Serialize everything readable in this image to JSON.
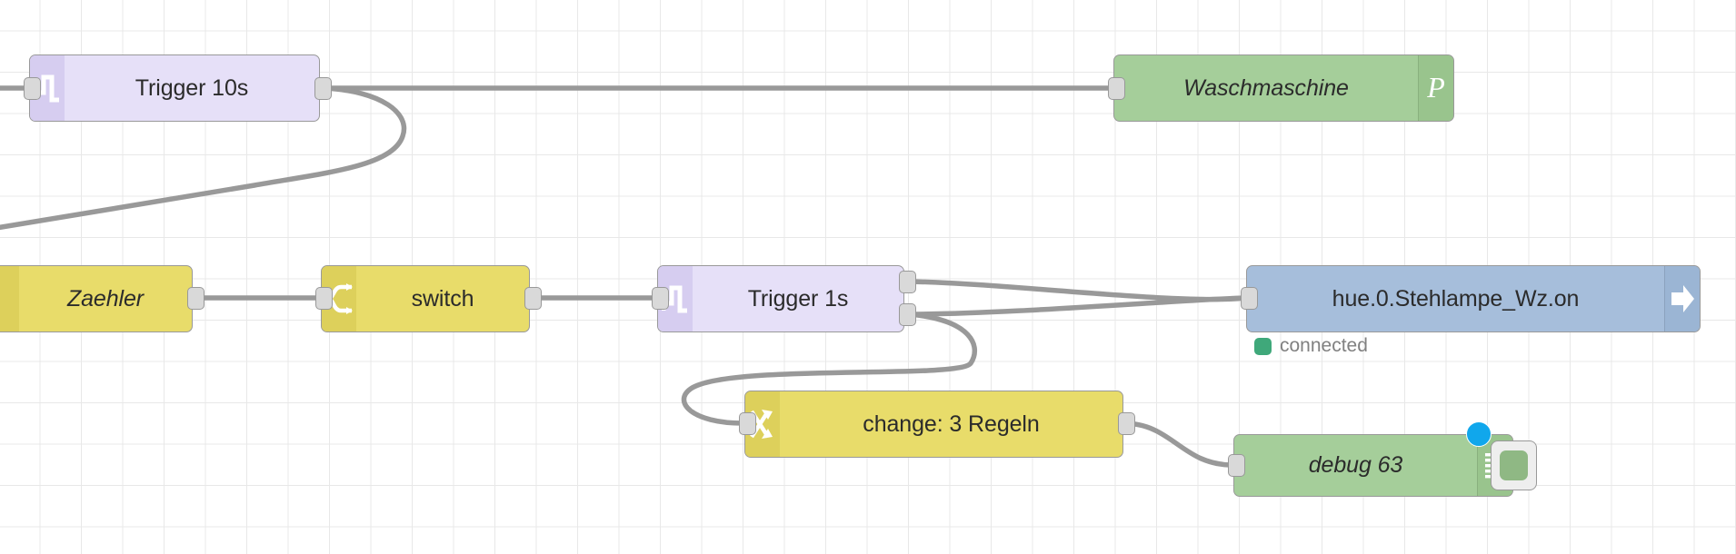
{
  "canvas": {
    "name": "node-red-flow-canvas",
    "grid_color": "#e8e8e8",
    "background": "#ffffff",
    "wire_color": "#999999"
  },
  "palette": {
    "trigger_fill": "#e6e0f8",
    "function_fill": "#e8dc6a",
    "green_fill": "#a5ce9a",
    "blue_fill": "#a6bedb",
    "port_fill": "#d9d9d9",
    "status_green": "#3fa87a",
    "badge_blue": "#10a7ec"
  },
  "nodes": {
    "trigger10s": {
      "label": "Trigger 10s",
      "icon": "pulse-icon",
      "type": "trigger"
    },
    "waschmaschine": {
      "label": "Waschmaschine",
      "icon": "pushover-p-icon",
      "type": "notification"
    },
    "zaehler": {
      "label": "Zaehler",
      "icon": "function-icon",
      "type": "function"
    },
    "switch": {
      "label": "switch",
      "icon": "switch-branch-icon",
      "type": "switch"
    },
    "trigger1s": {
      "label": "Trigger 1s",
      "icon": "pulse-icon",
      "type": "trigger"
    },
    "hue": {
      "label": "hue.0.Stehlampe_Wz.on",
      "icon": "arrow-right-icon",
      "type": "iobroker-out",
      "status": "connected",
      "status_color": "#3fa87a"
    },
    "change": {
      "label": "change: 3 Regeln",
      "icon": "change-swap-icon",
      "type": "change"
    },
    "debug": {
      "label": "debug 63",
      "icon": "debug-lines-icon",
      "type": "debug",
      "button_label": "",
      "has_unread_badge": true
    }
  }
}
